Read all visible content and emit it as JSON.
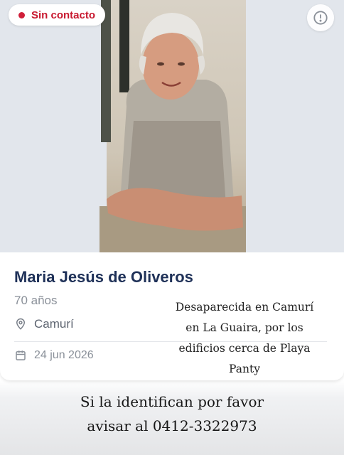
{
  "status_badge": {
    "label": "Sin contacto",
    "color": "#c8182f"
  },
  "info_button": {
    "icon": "alert-circle-icon"
  },
  "person": {
    "name": "Maria Jesús de Oliveros",
    "age": "70 años",
    "location": "Camurí",
    "date": "24 jun 2026"
  },
  "icons": {
    "location": "map-pin-icon",
    "date": "calendar-icon"
  },
  "description_lines": [
    "Desaparecida en Camurí",
    "en La Guaira, por los",
    "edificios cerca de Playa",
    "Panty"
  ],
  "footer_lines": [
    "Si la identifican por favor",
    "avisar al 0412-3322973"
  ],
  "colors": {
    "name": "#1f3158",
    "muted": "#8a9099",
    "alert": "#d01f3a"
  }
}
